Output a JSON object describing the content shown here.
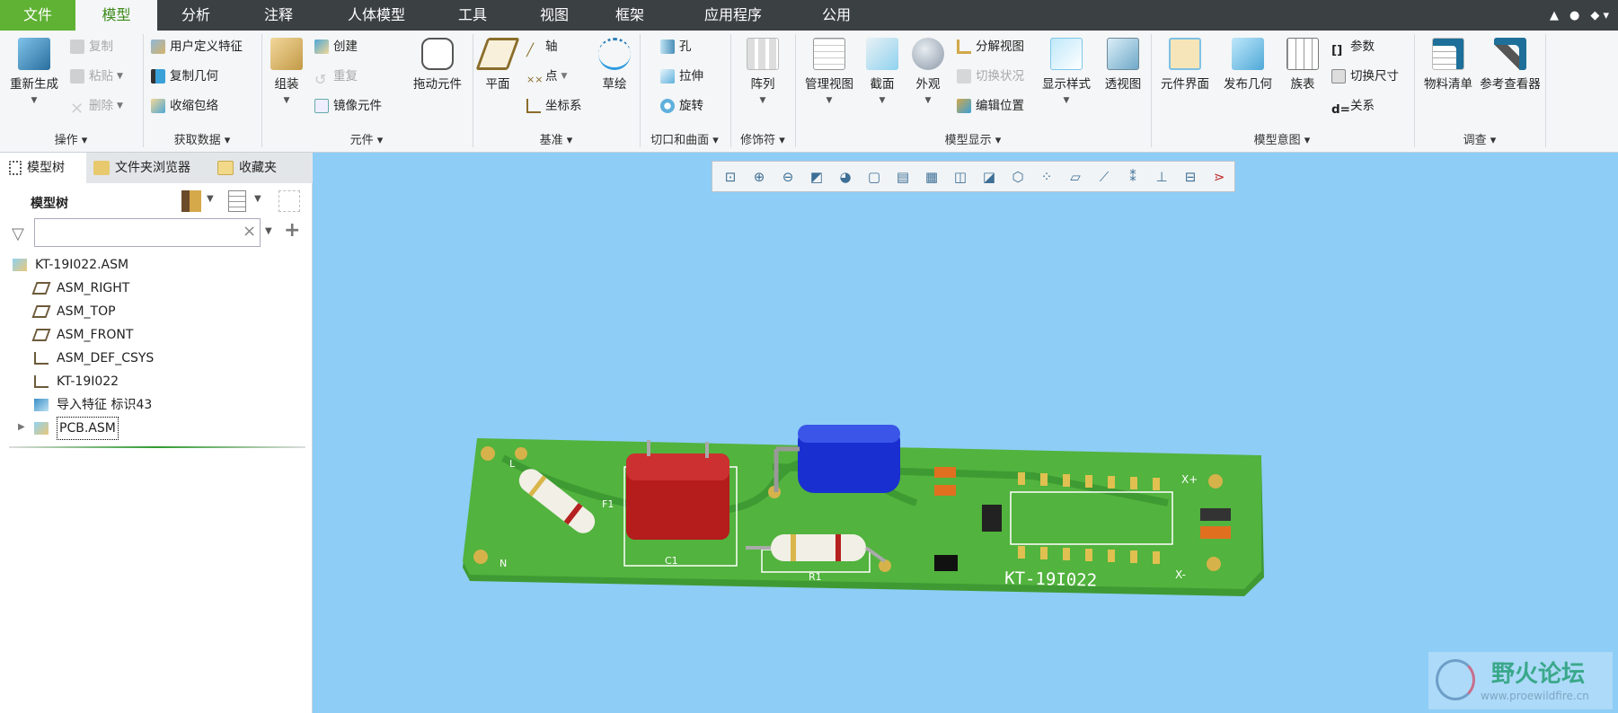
{
  "menu": {
    "tabs": [
      "文件",
      "模型",
      "分析",
      "注释",
      "人体模型",
      "工具",
      "视图",
      "框架",
      "应用程序",
      "公用"
    ]
  },
  "ribbon": {
    "groups": [
      "操作",
      "获取数据",
      "元件",
      "基准",
      "切口和曲面",
      "修饰符",
      "模型显示",
      "模型意图",
      "调查"
    ],
    "big": [
      "重新生成",
      "组装",
      "拖动元件",
      "平面",
      "草绘",
      "阵列",
      "管理视图",
      "截面",
      "外观",
      "显示样式",
      "透视图",
      "元件界面",
      "发布几何",
      "族表",
      "物料清单",
      "参考查看器"
    ],
    "small": [
      "复制",
      "粘贴",
      "删除",
      "用户定义特征",
      "复制几何",
      "收缩包络",
      "创建",
      "重复",
      "镜像元件",
      "轴",
      "点",
      "坐标系",
      "孔",
      "拉伸",
      "旋转",
      "分解视图",
      "切换状况",
      "编辑位置",
      "参数",
      "切换尺寸",
      "关系"
    ]
  },
  "panel": {
    "tabs": [
      "模型树",
      "文件夹浏览器",
      "收藏夹"
    ],
    "header": "模型树",
    "search_value": "",
    "clear": "×",
    "add": "+",
    "tree": [
      "KT-19I022.ASM",
      "ASM_RIGHT",
      "ASM_TOP",
      "ASM_FRONT",
      "ASM_DEF_CSYS",
      "KT-19I022",
      "导入特征 标识43",
      "PCB.ASM"
    ]
  },
  "pcb": {
    "label": "KT-19I022",
    "xplus": "X+",
    "xminus": "X-",
    "n": "N",
    "l": "L",
    "f1": "F1",
    "c1": "C1",
    "r1": "R1"
  },
  "watermark": {
    "title": "野火论坛",
    "url": "www.proewildfire.cn"
  },
  "colors": {
    "accent": "#5fb233",
    "viewport": "#8ecdf6",
    "pcb": "#4caf3a"
  }
}
